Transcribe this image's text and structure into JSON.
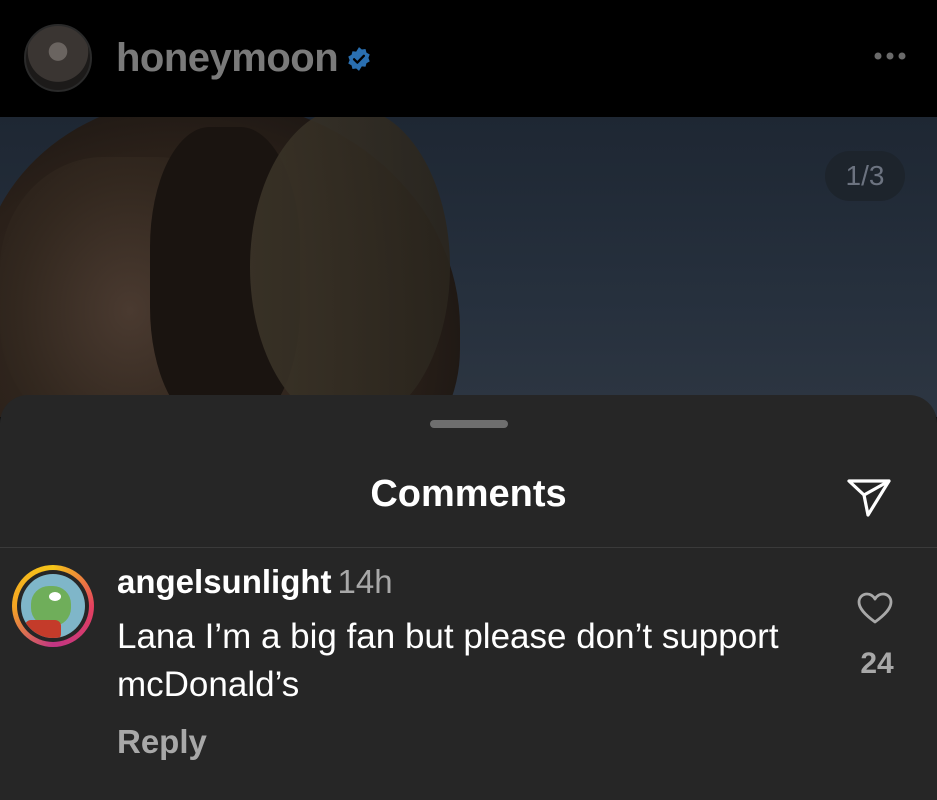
{
  "post": {
    "username": "honeymoon",
    "verified": true,
    "avatar_icon": "profile-avatar",
    "more_icon": "ellipsis-icon",
    "image_counter": "1/3"
  },
  "comments_sheet": {
    "title": "Comments",
    "share_icon": "paper-plane-icon",
    "comments": [
      {
        "username": "angelsunlight",
        "time": "14h",
        "text": "Lana I’m a big fan but please don’t support mcDonald’s",
        "reply_label": "Reply",
        "like_icon": "heart-outline-icon",
        "like_count": "24"
      }
    ]
  },
  "colors": {
    "background": "#000000",
    "sheet": "#262626",
    "muted_text": "#a8a8a8",
    "verified_badge": "#3897f0"
  }
}
